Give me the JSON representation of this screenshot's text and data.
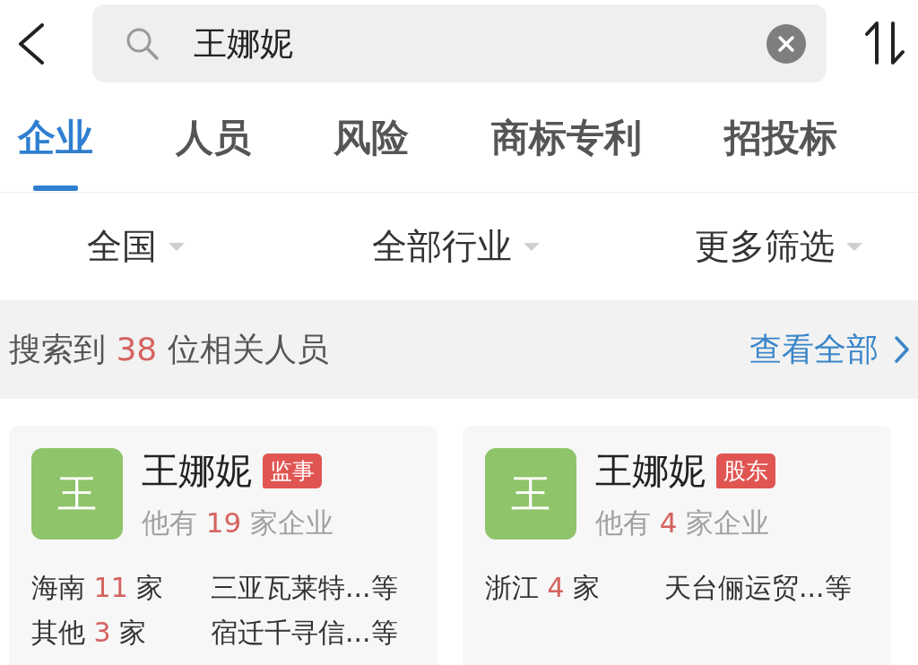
{
  "search_bar": {
    "query": "王娜妮"
  },
  "tabs": [
    {
      "label": "企业",
      "selected": true
    },
    {
      "label": "人员",
      "selected": false
    },
    {
      "label": "风险",
      "selected": false
    },
    {
      "label": "商标专利",
      "selected": false
    },
    {
      "label": "招投标",
      "selected": false
    }
  ],
  "filters": [
    {
      "label": "全国"
    },
    {
      "label": "全部行业"
    },
    {
      "label": "更多筛选"
    }
  ],
  "result_summary": {
    "prefix": "搜索到",
    "count": "38",
    "suffix": "位相关人员",
    "link": "查看全部"
  },
  "people": [
    {
      "avatar_text": "王",
      "name": "王娜妮",
      "role": "监事",
      "company_summary": {
        "prefix": "他有",
        "count": "19",
        "suffix": "家企业"
      },
      "regions": [
        {
          "region": "海南",
          "count": "11",
          "unit": "家",
          "companies": "三亚瓦莱特...等"
        },
        {
          "region": "其他",
          "count": "3",
          "unit": "家",
          "companies": "宿迁千寻信...等"
        }
      ]
    },
    {
      "avatar_text": "王",
      "name": "王娜妮",
      "role": "股东",
      "company_summary": {
        "prefix": "他有",
        "count": "4",
        "suffix": "家企业"
      },
      "regions": [
        {
          "region": "浙江",
          "count": "4",
          "unit": "家",
          "companies": "天台俪运贸...等"
        }
      ]
    }
  ]
}
